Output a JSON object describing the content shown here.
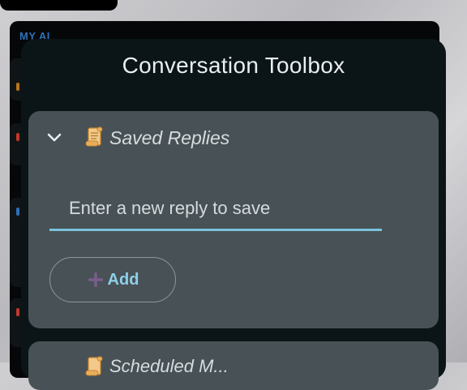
{
  "background": {
    "label": "MY AI"
  },
  "modal": {
    "title": "Conversation Toolbox",
    "sections": [
      {
        "title": "Saved Replies",
        "icon": "scroll-icon",
        "expanded": true,
        "input": {
          "placeholder": "Enter a new reply to save",
          "value": ""
        },
        "add_label": "Add"
      },
      {
        "title": "Scheduled M...",
        "icon": "scroll-icon",
        "expanded": false
      }
    ]
  },
  "colors": {
    "accent": "#79c3dc",
    "button_text": "#8fd0ea",
    "section_bg": "#485155",
    "modal_bg": "#0b1417"
  }
}
